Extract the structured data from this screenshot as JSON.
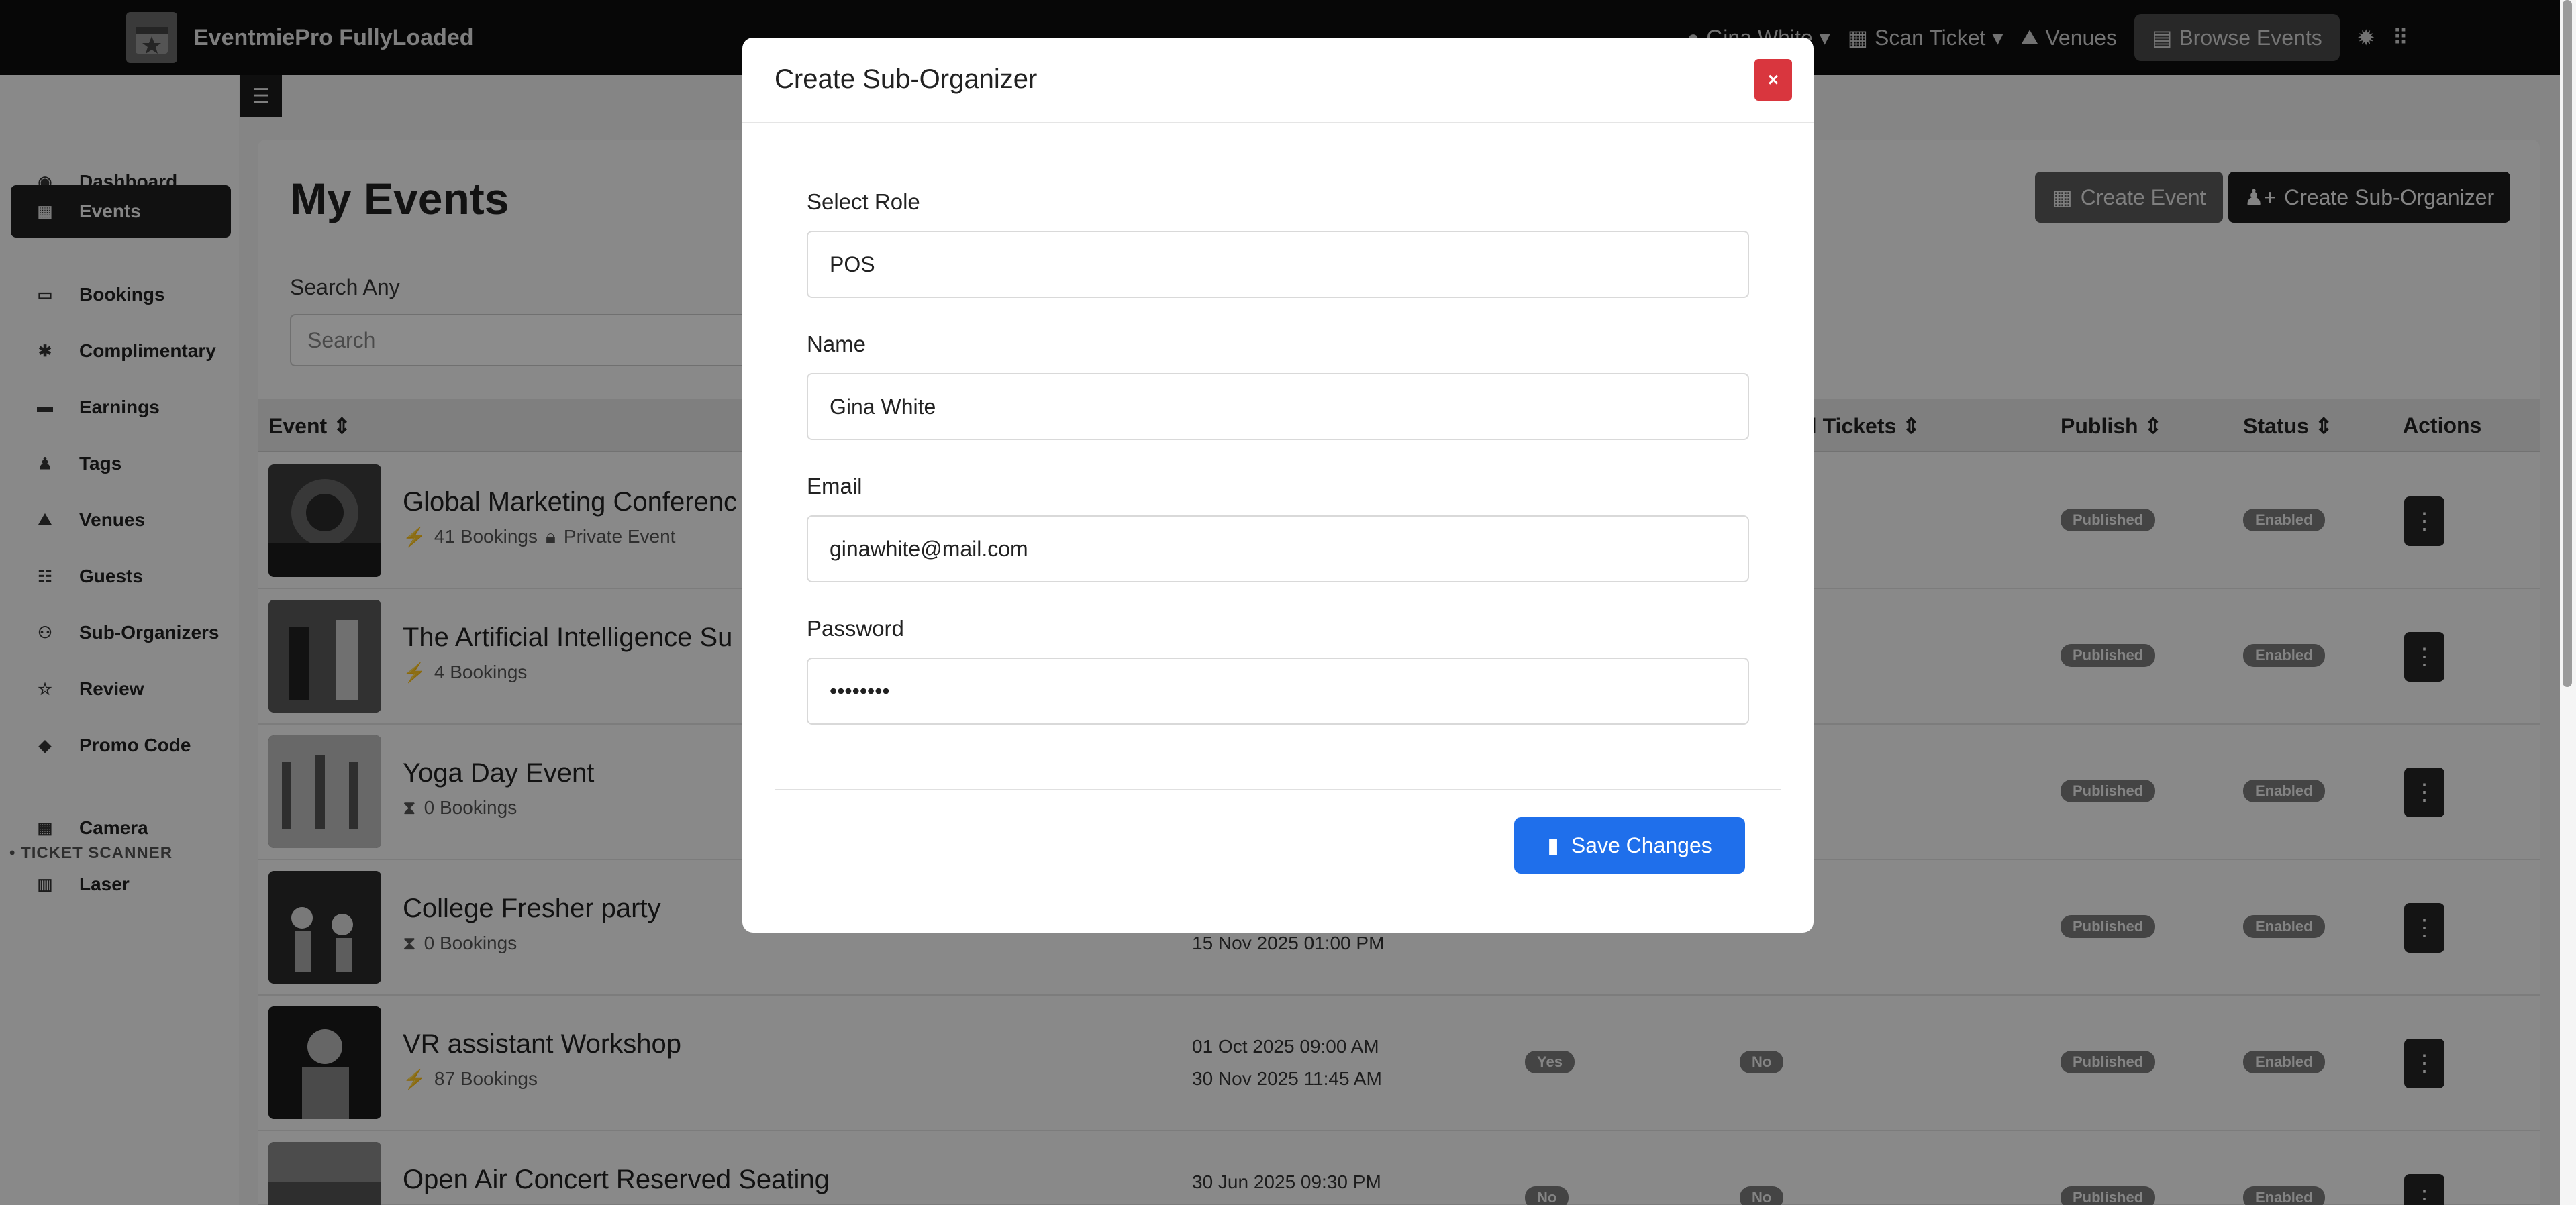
{
  "app": {
    "brand": "EventmiePro FullyLoaded"
  },
  "topnav": {
    "user": "Gina White",
    "scan_ticket": "Scan Ticket",
    "venues": "Venues",
    "browse_events": "Browse Events"
  },
  "sidebar": {
    "items": [
      {
        "label": "Dashboard",
        "icon": "dashboard-icon"
      },
      {
        "label": "Events",
        "icon": "calendar-icon",
        "active": true
      },
      {
        "label": "Bookings",
        "icon": "ticket-icon"
      },
      {
        "label": "Complimentary",
        "icon": "gift-icon"
      },
      {
        "label": "Earnings",
        "icon": "wallet-icon"
      },
      {
        "label": "Tags",
        "icon": "user-tag-icon"
      },
      {
        "label": "Venues",
        "icon": "map-icon"
      },
      {
        "label": "Guests",
        "icon": "users-icon"
      },
      {
        "label": "Sub-Organizers",
        "icon": "user-group-icon"
      },
      {
        "label": "Review",
        "icon": "star-icon"
      },
      {
        "label": "Promo Code",
        "icon": "tag-icon"
      }
    ],
    "section": "TICKET SCANNER",
    "scanner_items": [
      {
        "label": "Camera",
        "icon": "qr-icon"
      },
      {
        "label": "Laser",
        "icon": "barcode-icon"
      }
    ]
  },
  "page": {
    "title": "My Events",
    "search_label": "Search Any",
    "search_placeholder": "Search",
    "create_event": "Create Event",
    "create_sub_organizer": "Create Sub-Organizer"
  },
  "table": {
    "headers": {
      "event": "Event",
      "tickets": "al Tickets",
      "publish": "Publish",
      "status": "Status",
      "actions": "Actions"
    },
    "rows": [
      {
        "title": "Global Marketing Conferenc",
        "meta": "41 Bookings",
        "extra": "Private Event",
        "publish": "Published",
        "status": "Enabled"
      },
      {
        "title": "The Artificial Intelligence Su",
        "meta": "4 Bookings",
        "publish": "Published",
        "status": "Enabled"
      },
      {
        "title": "Yoga Day Event",
        "meta": "0 Bookings",
        "publish": "Published",
        "status": "Enabled"
      },
      {
        "title": "College Fresher party",
        "meta": "0 Bookings",
        "date_end": "15 Nov 2025 01:00 PM",
        "publish": "Published",
        "status": "Enabled"
      },
      {
        "title": "VR assistant Workshop",
        "meta": "87 Bookings",
        "date_start": "01 Oct 2025 09:00 AM",
        "date_end": "30 Nov 2025 11:45 AM",
        "col_a": "Yes",
        "col_b": "No",
        "publish": "Published",
        "status": "Enabled"
      },
      {
        "title": "Open Air Concert Reserved Seating",
        "date_start": "30 Jun 2025 09:30 PM",
        "col_a": "No",
        "col_b": "No",
        "publish": "Published",
        "status": "Enabled"
      }
    ]
  },
  "modal": {
    "title": "Create Sub-Organizer",
    "close": "×",
    "role_label": "Select Role",
    "role_value": "POS",
    "name_label": "Name",
    "name_value": "Gina White",
    "email_label": "Email",
    "email_value": "ginawhite@mail.com",
    "password_label": "Password",
    "password_value": "••••••••",
    "save": "Save Changes"
  },
  "colors": {
    "primary": "#1f6feb",
    "danger": "#d9363e",
    "dark": "#1d1d1d"
  }
}
